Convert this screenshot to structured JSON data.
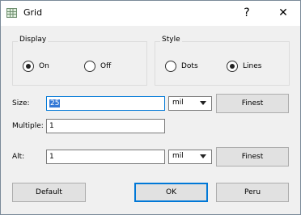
{
  "window": {
    "title": "Grid",
    "help_glyph": "?",
    "close_glyph": "✕",
    "icon": "grid-app-icon"
  },
  "display_group": {
    "label": "Display",
    "options": [
      {
        "label": "On",
        "checked": true
      },
      {
        "label": "Off",
        "checked": false
      }
    ]
  },
  "style_group": {
    "label": "Style",
    "options": [
      {
        "label": "Dots",
        "checked": false
      },
      {
        "label": "Lines",
        "checked": true
      }
    ]
  },
  "size": {
    "label": "Size:",
    "value": "25",
    "unit": "mil",
    "button": "Finest"
  },
  "multiple": {
    "label": "Multiple:",
    "value": "1"
  },
  "alt": {
    "label": "Alt:",
    "value": "1",
    "unit": "mil",
    "button": "Finest"
  },
  "footer": {
    "default_label": "Default",
    "ok_label": "OK",
    "peru_label": "Peru"
  }
}
